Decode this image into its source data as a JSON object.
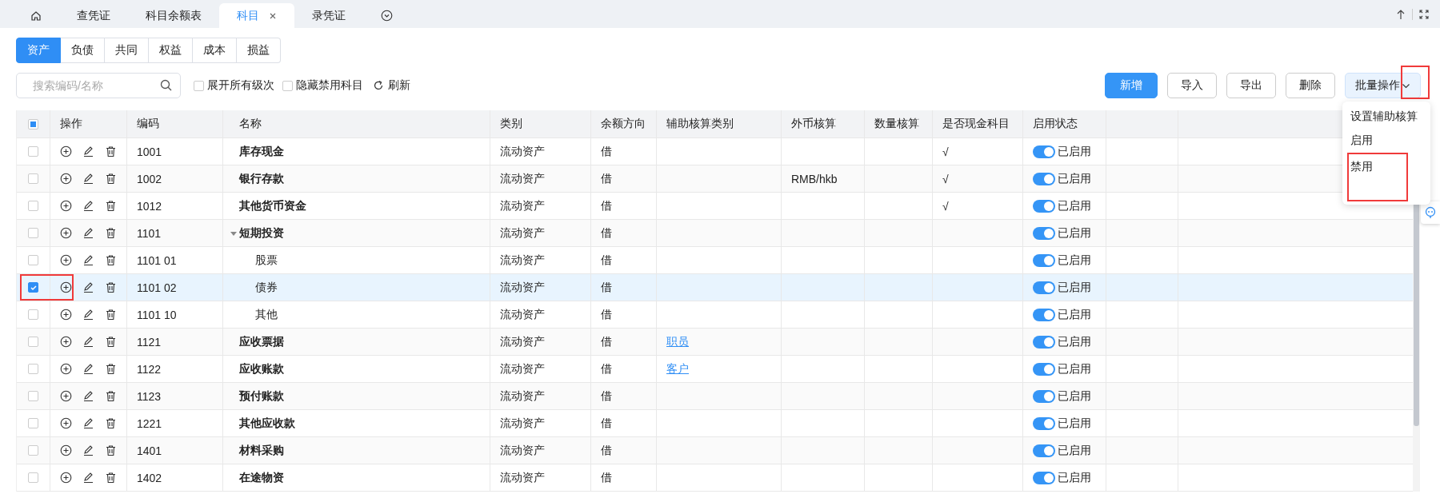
{
  "top_tabs": [
    {
      "kind": "home",
      "selected": false
    },
    {
      "label": "查凭证",
      "selected": false
    },
    {
      "label": "科目余额表",
      "selected": false
    },
    {
      "label": "科目",
      "selected": true,
      "closable": true
    },
    {
      "label": "录凭证",
      "selected": false
    },
    {
      "kind": "more",
      "selected": false
    }
  ],
  "category_tabs": [
    {
      "label": "资产",
      "selected": true
    },
    {
      "label": "负债",
      "selected": false
    },
    {
      "label": "共同",
      "selected": false
    },
    {
      "label": "权益",
      "selected": false
    },
    {
      "label": "成本",
      "selected": false
    },
    {
      "label": "损益",
      "selected": false
    }
  ],
  "search": {
    "placeholder": "搜索编码/名称"
  },
  "options": [
    {
      "label": "展开所有级次",
      "checked": false
    },
    {
      "label": "隐藏禁用科目",
      "checked": false
    }
  ],
  "refresh": {
    "label": "刷新"
  },
  "buttons": [
    {
      "label": "新增",
      "kind": "primary"
    },
    {
      "label": "导入",
      "kind": "default"
    },
    {
      "label": "导出",
      "kind": "default"
    },
    {
      "label": "删除",
      "kind": "default"
    },
    {
      "label": "批量操作",
      "kind": "dropdown",
      "annotated": true
    }
  ],
  "dropdown_menu": [
    {
      "label": "设置辅助核算",
      "annotated": false
    },
    {
      "label": "启用",
      "annotated": false
    },
    {
      "label": "禁用",
      "annotated": true
    }
  ],
  "table": {
    "header_checkbox": {
      "indeterminate": true
    },
    "columns": [
      "操作",
      "编码",
      "名称",
      "类别",
      "余额方向",
      "辅助核算类别",
      "外币核算",
      "数量核算",
      "是否现金科目",
      "启用状态"
    ],
    "rows": [
      {
        "code": "1001",
        "name": "库存现金",
        "category": "流动资产",
        "direction": "借",
        "currency": "",
        "cash": "√",
        "status": {
          "on": true,
          "label": "已启用"
        },
        "checked": false
      },
      {
        "code": "1002",
        "name": "银行存款",
        "category": "流动资产",
        "direction": "借",
        "currency": "RMB/hkb",
        "cash": "√",
        "status": {
          "on": true,
          "label": "已启用"
        },
        "checked": false
      },
      {
        "code": "1012",
        "name": "其他货币资金",
        "category": "流动资产",
        "direction": "借",
        "currency": "",
        "cash": "√",
        "status": {
          "on": true,
          "label": "已启用"
        },
        "checked": false
      },
      {
        "code": "1101",
        "name": "短期投资",
        "category": "流动资产",
        "direction": "借",
        "status": {
          "on": true,
          "label": "已启用"
        },
        "checked": false,
        "expanded": true,
        "children": [
          {
            "code": "1101 01",
            "name": "股票",
            "category": "流动资产",
            "direction": "借",
            "status": {
              "on": true,
              "label": "已启用"
            },
            "checked": false
          },
          {
            "code": "1101 02",
            "name": "债券",
            "category": "流动资产",
            "direction": "借",
            "status": {
              "on": true,
              "label": "已启用"
            },
            "checked": true,
            "annotated": true
          },
          {
            "code": "1101 10",
            "name": "其他",
            "category": "流动资产",
            "direction": "借",
            "status": {
              "on": true,
              "label": "已启用"
            },
            "checked": false
          }
        ]
      },
      {
        "code": "1121",
        "name": "应收票据",
        "category": "流动资产",
        "direction": "借",
        "aux": "职员",
        "status": {
          "on": true,
          "label": "已启用"
        },
        "checked": false
      },
      {
        "code": "1122",
        "name": "应收账款",
        "category": "流动资产",
        "direction": "借",
        "aux": "客户",
        "status": {
          "on": true,
          "label": "已启用"
        },
        "checked": false
      },
      {
        "code": "1123",
        "name": "预付账款",
        "category": "流动资产",
        "direction": "借",
        "status": {
          "on": true,
          "label": "已启用"
        },
        "checked": false
      },
      {
        "code": "1221",
        "name": "其他应收款",
        "category": "流动资产",
        "direction": "借",
        "status": {
          "on": true,
          "label": "已启用"
        },
        "checked": false
      },
      {
        "code": "1401",
        "name": "材料采购",
        "category": "流动资产",
        "direction": "借",
        "status": {
          "on": true,
          "label": "已启用"
        },
        "checked": false
      },
      {
        "code": "1402",
        "name": "在途物资",
        "category": "流动资产",
        "direction": "借",
        "status": {
          "on": true,
          "label": "已启用"
        },
        "checked": false
      }
    ]
  }
}
